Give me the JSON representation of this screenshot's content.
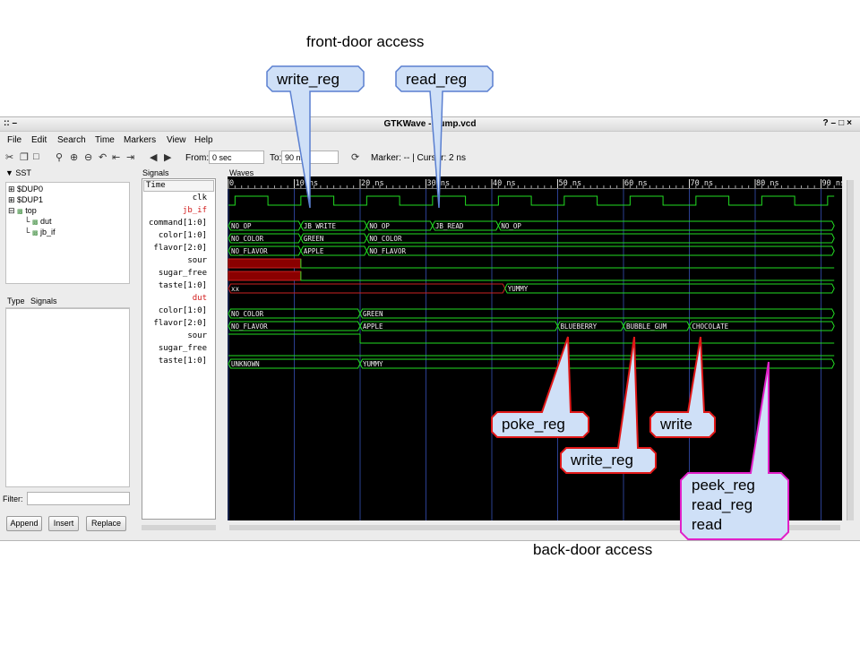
{
  "annotations": {
    "front_door": "front-door access",
    "back_door": "back-door access",
    "write_reg_top": "write_reg",
    "read_reg_top": "read_reg",
    "poke_reg": "poke_reg",
    "write_reg_bottom": "write_reg",
    "write": "write",
    "peek_lines": [
      "peek_reg",
      "read_reg",
      "read"
    ]
  },
  "window": {
    "title": "GTKWave - dump.vcd",
    "menu": [
      "File",
      "Edit",
      "Search",
      "Time",
      "Markers",
      "View",
      "Help"
    ],
    "from_label": "From:",
    "from_value": "0 sec",
    "to_label": "To:",
    "to_value": "90 ns",
    "marker_text": "Marker: --  |  Cursor: 2 ns"
  },
  "sst": {
    "header": "SST",
    "tree": [
      "$DUP0",
      "$DUP1",
      "top",
      "dut",
      "jb_if"
    ],
    "type_col": "Type",
    "signals_col": "Signals",
    "filter_label": "Filter:",
    "buttons": [
      "Append",
      "Insert",
      "Replace"
    ]
  },
  "signals": {
    "header": "Signals",
    "time_label": "Time",
    "list": [
      {
        "name": "clk",
        "group": false
      },
      {
        "name": "jb_if",
        "group": true
      },
      {
        "name": "command[1:0]",
        "group": false
      },
      {
        "name": "color[1:0]",
        "group": false
      },
      {
        "name": "flavor[2:0]",
        "group": false
      },
      {
        "name": "sour",
        "group": false
      },
      {
        "name": "sugar_free",
        "group": false
      },
      {
        "name": "taste[1:0]",
        "group": false
      },
      {
        "name": "dut",
        "group": true
      },
      {
        "name": "color[1:0]",
        "group": false
      },
      {
        "name": "flavor[2:0]",
        "group": false
      },
      {
        "name": "sour",
        "group": false
      },
      {
        "name": "sugar_free",
        "group": false
      },
      {
        "name": "taste[1:0]",
        "group": false
      }
    ]
  },
  "waves": {
    "header": "Waves",
    "time_max": 92,
    "ticks": [
      "0",
      "10 ns",
      "20 ns",
      "30 ns",
      "40 ns",
      "50 ns",
      "60 ns",
      "70 ns",
      "80 ns",
      "90 ns"
    ],
    "wave_color": "#22dd22",
    "undefined_color": "#cc2222",
    "rows": [
      {
        "kind": "clock",
        "half_period": 5,
        "start": 1
      },
      null,
      {
        "kind": "bus",
        "segments": [
          [
            0,
            11,
            "NO_OP"
          ],
          [
            11,
            21,
            "JB_WRITE"
          ],
          [
            21,
            31,
            "NO_OP"
          ],
          [
            31,
            41,
            "JB_READ"
          ],
          [
            41,
            92,
            "NO_OP"
          ]
        ]
      },
      {
        "kind": "bus",
        "segments": [
          [
            0,
            11,
            "NO_COLOR"
          ],
          [
            11,
            21,
            "GREEN"
          ],
          [
            21,
            92,
            "NO_COLOR"
          ]
        ]
      },
      {
        "kind": "bus",
        "segments": [
          [
            0,
            11,
            "NO_FLAVOR"
          ],
          [
            11,
            21,
            "APPLE"
          ],
          [
            21,
            92,
            "NO_FLAVOR"
          ]
        ]
      },
      {
        "kind": "bit",
        "segments": [
          [
            0,
            11,
            "x"
          ],
          [
            11,
            92,
            0
          ]
        ]
      },
      {
        "kind": "bit",
        "segments": [
          [
            0,
            11,
            "x"
          ],
          [
            11,
            92,
            0
          ]
        ]
      },
      {
        "kind": "bus",
        "segments": [
          [
            0,
            42,
            "xx",
            true
          ],
          [
            42,
            92,
            "YUMMY"
          ]
        ]
      },
      null,
      {
        "kind": "bus",
        "segments": [
          [
            0,
            20,
            "NO_COLOR"
          ],
          [
            20,
            92,
            "GREEN"
          ]
        ]
      },
      {
        "kind": "bus",
        "segments": [
          [
            0,
            20,
            "NO_FLAVOR"
          ],
          [
            20,
            50,
            "APPLE"
          ],
          [
            50,
            60,
            "BLUEBERRY"
          ],
          [
            60,
            70,
            "BUBBLE_GUM"
          ],
          [
            70,
            92,
            "CHOCOLATE"
          ]
        ]
      },
      {
        "kind": "bit",
        "segments": [
          [
            0,
            20,
            1
          ],
          [
            20,
            92,
            0
          ]
        ]
      },
      {
        "kind": "bit",
        "segments": [
          [
            0,
            92,
            0
          ]
        ]
      },
      {
        "kind": "bus",
        "segments": [
          [
            0,
            20,
            "UNKNOWN"
          ],
          [
            20,
            92,
            "YUMMY"
          ]
        ]
      }
    ]
  }
}
